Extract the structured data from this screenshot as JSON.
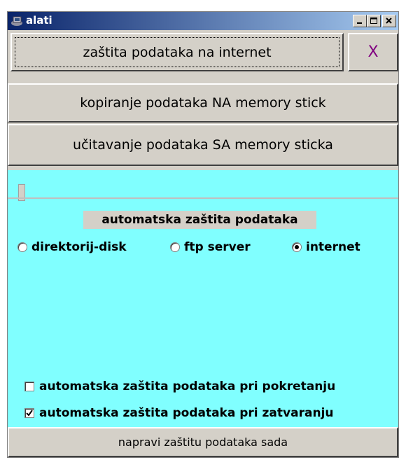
{
  "window": {
    "title": "alati"
  },
  "buttons": {
    "internet_backup": "zaštita podataka na internet",
    "close_x": "X",
    "copy_to_stick": "kopiranje podataka NA memory stick",
    "load_from_stick": "učitavanje podataka SA memory sticka",
    "backup_now": "napravi zaštitu podataka sada"
  },
  "auto_backup": {
    "label": "automatska zaštita podataka",
    "options": [
      {
        "label": "direktorij-disk",
        "selected": false
      },
      {
        "label": "ftp server",
        "selected": false
      },
      {
        "label": "internet",
        "selected": true
      }
    ]
  },
  "checkboxes": [
    {
      "label": "automatska zaštita podataka pri pokretanju",
      "checked": false
    },
    {
      "label": "automatska zaštita podataka pri zatvaranju",
      "checked": true
    }
  ],
  "colors": {
    "panel_bg": "#80ffff",
    "title_start": "#0a246a",
    "x_color": "#800080"
  }
}
